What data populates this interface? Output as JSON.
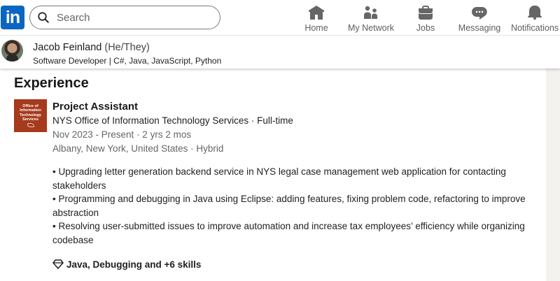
{
  "nav": {
    "logo_text": "in",
    "search_placeholder": "Search",
    "items": [
      {
        "label": "Home",
        "icon": "home-icon"
      },
      {
        "label": "My Network",
        "icon": "network-icon"
      },
      {
        "label": "Jobs",
        "icon": "briefcase-icon"
      },
      {
        "label": "Messaging",
        "icon": "messaging-icon"
      },
      {
        "label": "Notifications",
        "icon": "bell-icon"
      }
    ]
  },
  "profile_bar": {
    "name": "Jacob Feinland",
    "pronouns": "(He/They)",
    "headline": "Software Developer | C#, Java, JavaScript, Python"
  },
  "experience": {
    "section_title": "Experience",
    "org_logo_lines": [
      "Office of",
      "Information",
      "Technology",
      "Services"
    ],
    "title": "Project Assistant",
    "company": "NYS Office of Information Technology Services · Full-time",
    "dates": "Nov 2023 - Present · 2 yrs 2 mos",
    "location": "Albany, New York, United States · Hybrid",
    "bullets": [
      "• Upgrading letter generation backend service in NYS legal case management web application for contacting stakeholders",
      "• Programming and debugging in Java using Eclipse: adding features, fixing problem code, refactoring to improve abstraction",
      "• Resolving user-submitted issues to improve automation and increase tax employees’ efficiency while organizing codebase"
    ],
    "skills": "Java, Debugging and +6 skills"
  },
  "colors": {
    "brand": "#0a66c2",
    "org_logo_bg": "#a53a1c",
    "page_bg": "#f4f2ee"
  }
}
